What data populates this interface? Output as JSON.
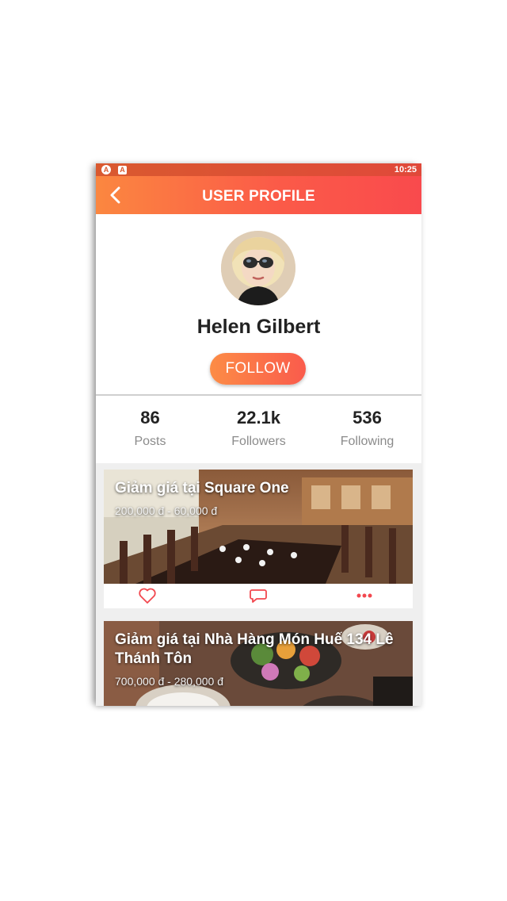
{
  "status_bar": {
    "time": "10:25",
    "icons": [
      "android-icon",
      "notification-a-icon"
    ]
  },
  "app_bar": {
    "title": "USER PROFILE",
    "back_icon": "chevron-left-icon"
  },
  "profile": {
    "name": "Helen Gilbert",
    "follow_label": "FOLLOW"
  },
  "stats": [
    {
      "value": "86",
      "label": "Posts"
    },
    {
      "value": "22.1k",
      "label": "Followers"
    },
    {
      "value": "536",
      "label": "Following"
    }
  ],
  "posts": [
    {
      "title": "Giảm giá tại Square One",
      "price": "200,000 đ - 60,000 đ"
    },
    {
      "title": "Giảm giá tại Nhà Hàng Món Huế 134 Lê Thánh Tôn",
      "price": "700,000 đ - 280,000 đ"
    }
  ],
  "post_actions": [
    "heart-icon",
    "comment-icon",
    "more-dots-icon"
  ],
  "colors": {
    "accent_start": "#fb8740",
    "accent_end": "#f94a4d",
    "action_icon": "#f2484f"
  }
}
